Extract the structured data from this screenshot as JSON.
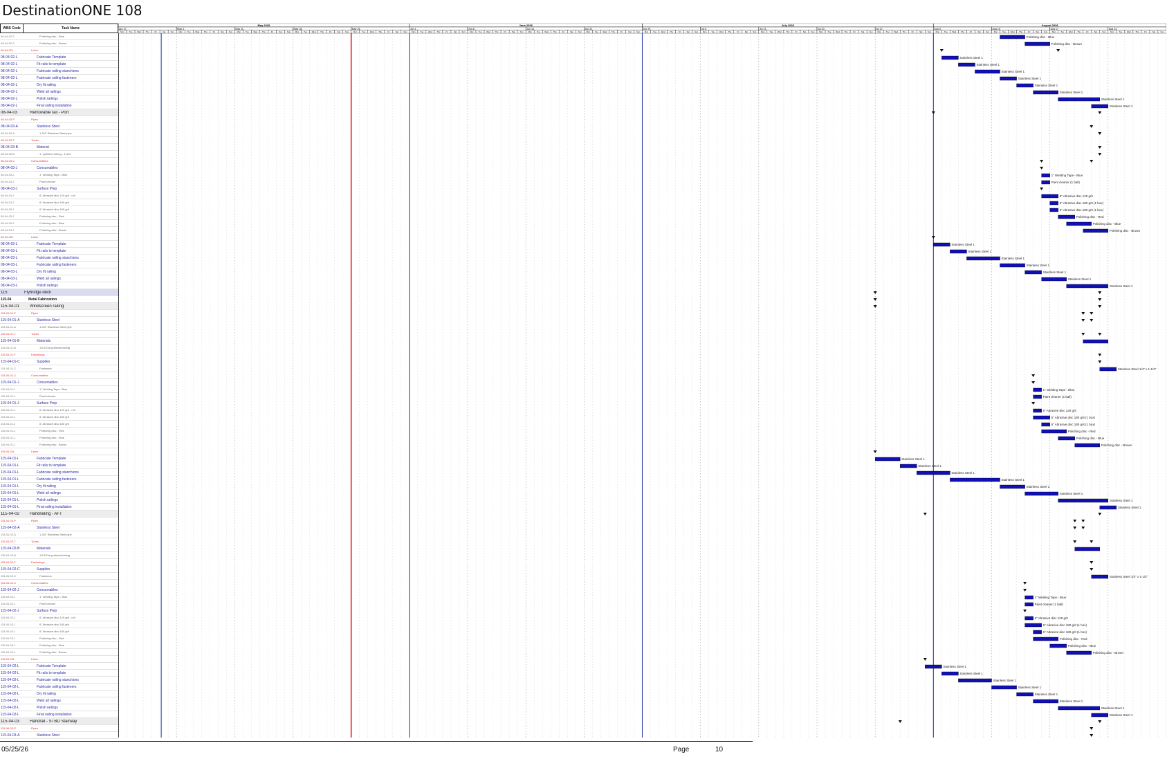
{
  "title": "DestinationONE 108",
  "columns": {
    "wbs": "WBS Code",
    "task": "Task Name"
  },
  "months": [
    {
      "label": "May 2026",
      "start": "2026-04-27",
      "end": "2026-05-31"
    },
    {
      "label": "June 2026",
      "start": "2026-06-01",
      "end": "2026-06-28"
    },
    {
      "label": "July 2026",
      "start": "2026-06-29",
      "end": "2026-08-02"
    },
    {
      "label": "August 2026",
      "start": "2026-08-03",
      "end": "2026-08-30"
    }
  ],
  "weeks": [
    "Apr 27",
    "May 4",
    "May 11",
    "May 18",
    "May 25",
    "Jun 1",
    "Jun 8",
    "Jun 15",
    "Jun 22",
    "Jun 29",
    "Jul 6",
    "Jul 13",
    "Jul 20",
    "Jul 27",
    "Aug 3",
    "Aug 10",
    "Aug 17",
    "Aug 24"
  ],
  "weekdays": [
    "Mon",
    "Tue",
    "Wed",
    "Thu",
    "Fri",
    "Sat",
    "Sun"
  ],
  "rows": [
    {
      "code": "08-04-02-2",
      "name": "Polishing disc - Blue",
      "type": "sub",
      "bar": [
        "2026-08-11",
        "2026-08-13"
      ],
      "label": "Polishing disc - Blue"
    },
    {
      "code": "08-04-02-2",
      "name": "Polishing disc - Brown",
      "type": "sub",
      "bar": [
        "2026-08-14",
        "2026-08-16"
      ],
      "label": "Polishing disc - Brown"
    },
    {
      "code": "08-04-02L",
      "name": "Labor",
      "type": "cat",
      "ms": [
        "2026-08-04",
        "2026-08-18"
      ]
    },
    {
      "code": "08-04-02-L",
      "name": "Fabricate Template",
      "type": "task",
      "bar": [
        "2026-08-04",
        "2026-08-05"
      ],
      "label": "Stainless Steel 1"
    },
    {
      "code": "08-04-02-L",
      "name": "Fit rails to template",
      "type": "task",
      "bar": [
        "2026-08-06",
        "2026-08-07"
      ],
      "label": "Stainless Steel 1"
    },
    {
      "code": "08-04-02-L",
      "name": "Fabricate railing stanchions",
      "type": "task",
      "bar": [
        "2026-08-08",
        "2026-08-10"
      ],
      "label": "Stainless Steel 1"
    },
    {
      "code": "08-04-02-L",
      "name": "Fabricate railing fasteners",
      "type": "task",
      "bar": [
        "2026-08-11",
        "2026-08-12"
      ],
      "label": "Stainless Steel 1"
    },
    {
      "code": "08-04-02-L",
      "name": "Dry fit railing",
      "type": "task",
      "bar": [
        "2026-08-13",
        "2026-08-14"
      ],
      "label": "Stainless Steel 1"
    },
    {
      "code": "08-04-02-L",
      "name": "Weld all railings",
      "type": "task",
      "bar": [
        "2026-08-15",
        "2026-08-17"
      ],
      "label": "Stainless Steel 1"
    },
    {
      "code": "08-04-02-L",
      "name": "Polish railings",
      "type": "task",
      "bar": [
        "2026-08-18",
        "2026-08-22"
      ],
      "label": "Stainless Steel 1"
    },
    {
      "code": "08-04-02-L",
      "name": "Final railing installation",
      "type": "task",
      "bar": [
        "2026-08-22",
        "2026-08-23"
      ],
      "label": "Stainless Steel 1"
    },
    {
      "code": "08-04-03",
      "name": "Removable rail - Port",
      "type": "group",
      "ms": [
        "2026-08-03",
        "2026-08-23"
      ]
    },
    {
      "code": "08-04-03-P",
      "name": "Pipes",
      "type": "cat"
    },
    {
      "code": "08-04-03-A",
      "name": "Stainless Steel",
      "type": "task",
      "ms": [
        "2026-08-22"
      ]
    },
    {
      "code": "08-04-03-A",
      "name": "1-3/4\" Stainless Steel pipe",
      "type": "sub",
      "ms": [
        "2026-08-23"
      ]
    },
    {
      "code": "08-04-03-T",
      "name": "Tubes",
      "type": "cat"
    },
    {
      "code": "08-04-03-B",
      "name": "Material",
      "type": "task",
      "ms": [
        "2026-08-23"
      ]
    },
    {
      "code": "08-04-03-B",
      "name": "1\" polished tubing - 4 feet",
      "type": "sub",
      "ms": [
        "2026-08-23"
      ]
    },
    {
      "code": "08-04-03-C",
      "name": "Consumables",
      "type": "cat",
      "ms": [
        "2026-08-16",
        "2026-08-22"
      ]
    },
    {
      "code": "08-04-03-J",
      "name": "Consumables",
      "type": "task",
      "ms": [
        "2026-08-16"
      ]
    },
    {
      "code": "08-04-03-J",
      "name": "1\" Welding Tape - Blue",
      "type": "sub",
      "bar": [
        "2026-08-16",
        "2026-08-16"
      ],
      "label": "1\" Welding Tape - Blue"
    },
    {
      "code": "08-04-03-J",
      "name": "Paint cleaner",
      "type": "sub",
      "bar": [
        "2026-08-16",
        "2026-08-16"
      ],
      "label": "Paint cleaner (1 ball)"
    },
    {
      "code": "08-04-03-J",
      "name": "Surface Prep",
      "type": "task",
      "ms": [
        "2026-08-16"
      ]
    },
    {
      "code": "08-04-03-J",
      "name": "6\" Abrasive disc 120 grit - roll",
      "type": "sub",
      "bar": [
        "2026-08-16",
        "2026-08-17"
      ],
      "label": "6\" Abrasive disc 120 grit"
    },
    {
      "code": "08-04-03-J",
      "name": "6\" Abrasive disc 180 grit",
      "type": "sub",
      "bar": [
        "2026-08-17",
        "2026-08-17"
      ],
      "label": "6\" Abrasive disc 180 grit (1 box)"
    },
    {
      "code": "08-04-03-J",
      "name": "6\" Abrasive disc 180 grit",
      "type": "sub",
      "bar": [
        "2026-08-17",
        "2026-08-17"
      ],
      "label": "6\" Abrasive disc 180 grit (1 box)"
    },
    {
      "code": "08-04-03-J",
      "name": "Polishing disc - Red",
      "type": "sub",
      "bar": [
        "2026-08-18",
        "2026-08-19"
      ],
      "label": "Polishing disc - Red"
    },
    {
      "code": "08-04-03-J",
      "name": "Polishing disc - Blue",
      "type": "sub",
      "bar": [
        "2026-08-19",
        "2026-08-21"
      ],
      "label": "Polishing disc - Blue"
    },
    {
      "code": "08-04-03-J",
      "name": "Polishing disc - Brown",
      "type": "sub",
      "bar": [
        "2026-08-21",
        "2026-08-23"
      ],
      "label": "Polishing disc - Brown"
    },
    {
      "code": "08-04-03L",
      "name": "Labor",
      "type": "cat",
      "ms": [
        "2026-08-03"
      ]
    },
    {
      "code": "08-04-03-L",
      "name": "Fabricate Template",
      "type": "task",
      "bar": [
        "2026-08-03",
        "2026-08-04"
      ],
      "label": "Stainless Steel 1"
    },
    {
      "code": "08-04-03-L",
      "name": "Fit rails to template",
      "type": "task",
      "bar": [
        "2026-08-05",
        "2026-08-06"
      ],
      "label": "Stainless Steel 1"
    },
    {
      "code": "08-04-03-L",
      "name": "Fabricate railing stanchions",
      "type": "task",
      "bar": [
        "2026-08-07",
        "2026-08-10"
      ],
      "label": "Stainless Steel 1"
    },
    {
      "code": "08-04-03-L",
      "name": "Fabricate railing fasteners",
      "type": "task",
      "bar": [
        "2026-08-11",
        "2026-08-13"
      ],
      "label": "Stainless Steel 1"
    },
    {
      "code": "08-04-03-L",
      "name": "Dry fit railing",
      "type": "task",
      "bar": [
        "2026-08-14",
        "2026-08-15"
      ],
      "label": "Stainless Steel 1"
    },
    {
      "code": "08-04-03-L",
      "name": "Weld all railings",
      "type": "task",
      "bar": [
        "2026-08-16",
        "2026-08-18"
      ],
      "label": "Stainless Steel 1"
    },
    {
      "code": "08-04-03-L",
      "name": "Polish railings",
      "type": "task",
      "bar": [
        "2026-08-19",
        "2026-08-23"
      ],
      "label": "Stainless Steel 1"
    },
    {
      "code": "115",
      "name": "Flybridge deck",
      "type": "phase",
      "ms": [
        "2026-07-27",
        "2026-08-23"
      ]
    },
    {
      "code": "115-04",
      "name": "Metal Fabrication",
      "type": "fab",
      "ms": [
        "2026-07-27",
        "2026-08-23"
      ]
    },
    {
      "code": "115-04-01",
      "name": "Windscreen railing",
      "type": "group",
      "ms": [
        "2026-07-27",
        "2026-08-23"
      ]
    },
    {
      "code": "115-04-01-P",
      "name": "Pipes",
      "type": "cat",
      "ms": [
        "2026-08-21",
        "2026-08-22"
      ]
    },
    {
      "code": "115-04-01-A",
      "name": "Stainless Steel",
      "type": "task",
      "ms": [
        "2026-08-21",
        "2026-08-22"
      ]
    },
    {
      "code": "115-04-01-A",
      "name": "1-3/4\" Stainless Steel pipe",
      "type": "sub"
    },
    {
      "code": "115-04-01-T",
      "name": "Tubes",
      "type": "cat",
      "ms": [
        "2026-08-21",
        "2026-08-23"
      ]
    },
    {
      "code": "115-04-01-B",
      "name": "Materials",
      "type": "task",
      "bar": [
        "2026-08-21",
        "2026-08-23"
      ]
    },
    {
      "code": "115-04-01-B",
      "name": "1/3.5 Dia polished tubing",
      "type": "sub"
    },
    {
      "code": "115-04-01-F",
      "name": "Fastenings",
      "type": "cat",
      "ms": [
        "2026-08-23"
      ]
    },
    {
      "code": "115-04-01-C",
      "name": "Supplies",
      "type": "task",
      "ms": [
        "2026-08-23"
      ]
    },
    {
      "code": "115-04-01-C",
      "name": "Fasteners",
      "type": "sub",
      "bar": [
        "2026-08-23",
        "2026-08-24"
      ],
      "label": "Stainless Steel 1/4\" x 1-1/2\""
    },
    {
      "code": "115-04-01-C",
      "name": "Consumables",
      "type": "cat",
      "ms": [
        "2026-08-15"
      ]
    },
    {
      "code": "115-04-01-J",
      "name": "Consumables",
      "type": "task",
      "ms": [
        "2026-08-15"
      ]
    },
    {
      "code": "115-04-01-J",
      "name": "1\" Welding Tape - Blue",
      "type": "sub",
      "bar": [
        "2026-08-15",
        "2026-08-15"
      ],
      "label": "1\" Welding Tape - Blue"
    },
    {
      "code": "115-04-01-J",
      "name": "Paint cleaner",
      "type": "sub",
      "bar": [
        "2026-08-15",
        "2026-08-15"
      ],
      "label": "Paint cleaner (1 ball)"
    },
    {
      "code": "115-04-01-J",
      "name": "Surface Prep",
      "type": "task",
      "ms": [
        "2026-08-15"
      ]
    },
    {
      "code": "115-04-01-J",
      "name": "6\" Abrasive disc 120 grit - roll",
      "type": "sub",
      "bar": [
        "2026-08-15",
        "2026-08-15"
      ],
      "label": "6\" Abrasive disc 120 grit"
    },
    {
      "code": "115-04-01-J",
      "name": "6\" Abrasive disc 180 grit",
      "type": "sub",
      "bar": [
        "2026-08-15",
        "2026-08-16"
      ],
      "label": "6\" Abrasive disc 180 grit (1 box)"
    },
    {
      "code": "115-04-01-J",
      "name": "6\" Abrasive disc 180 grit",
      "type": "sub",
      "bar": [
        "2026-08-16",
        "2026-08-16"
      ],
      "label": "6\" Abrasive disc 180 grit (1 box)"
    },
    {
      "code": "115-04-01-J",
      "name": "Polishing disc - Red",
      "type": "sub",
      "bar": [
        "2026-08-16",
        "2026-08-18"
      ],
      "label": "Polishing disc - Red"
    },
    {
      "code": "115-04-01-J",
      "name": "Polishing disc - Blue",
      "type": "sub",
      "bar": [
        "2026-08-18",
        "2026-08-19"
      ],
      "label": "Polishing disc - Blue"
    },
    {
      "code": "115-04-01-J",
      "name": "Polishing disc - Brown",
      "type": "sub",
      "bar": [
        "2026-08-20",
        "2026-08-22"
      ],
      "label": "Polishing disc - Brown"
    },
    {
      "code": "115-04-01L",
      "name": "Labor",
      "type": "cat",
      "ms": [
        "2026-07-27"
      ]
    },
    {
      "code": "115-04-01-L",
      "name": "Fabricate Template",
      "type": "task",
      "bar": [
        "2026-07-27",
        "2026-07-29"
      ],
      "label": "Stainless Steel 1"
    },
    {
      "code": "115-04-01-L",
      "name": "Fit rails to template",
      "type": "task",
      "bar": [
        "2026-07-30",
        "2026-07-31"
      ],
      "label": "Stainless Steel 1"
    },
    {
      "code": "115-04-01-L",
      "name": "Fabricate railing stanchions",
      "type": "task",
      "bar": [
        "2026-08-01",
        "2026-08-04"
      ],
      "label": "Stainless Steel 1"
    },
    {
      "code": "115-04-01-L",
      "name": "Fabricate railing fasteners",
      "type": "task",
      "bar": [
        "2026-08-05",
        "2026-08-10"
      ],
      "label": "Stainless Steel 1"
    },
    {
      "code": "115-04-01-L",
      "name": "Dry fit railing",
      "type": "task",
      "bar": [
        "2026-08-11",
        "2026-08-13"
      ],
      "label": "Stainless Steel 1"
    },
    {
      "code": "115-04-01-L",
      "name": "Weld all railings",
      "type": "task",
      "bar": [
        "2026-08-14",
        "2026-08-17"
      ],
      "label": "Stainless Steel 1"
    },
    {
      "code": "115-04-01-L",
      "name": "Polish railings",
      "type": "task",
      "bar": [
        "2026-08-18",
        "2026-08-23"
      ],
      "label": "Stainless Steel 1"
    },
    {
      "code": "115-04-01-L",
      "name": "Final railing installation",
      "type": "task",
      "bar": [
        "2026-08-23",
        "2026-08-24"
      ],
      "label": "Stainless Steel 1"
    },
    {
      "code": "115-04-02",
      "name": "Handrailing - AFT",
      "type": "group",
      "ms": [
        "2026-08-02",
        "2026-08-23"
      ]
    },
    {
      "code": "115-04-02-P",
      "name": "Pipes",
      "type": "cat",
      "ms": [
        "2026-08-20",
        "2026-08-21"
      ]
    },
    {
      "code": "115-04-02-A",
      "name": "Stainless Steel",
      "type": "task",
      "ms": [
        "2026-08-20",
        "2026-08-21"
      ]
    },
    {
      "code": "115-04-02-A",
      "name": "1-3/4\" Stainless Steel pipe",
      "type": "sub"
    },
    {
      "code": "115-04-02-T",
      "name": "Tubes",
      "type": "cat",
      "ms": [
        "2026-08-20",
        "2026-08-22"
      ]
    },
    {
      "code": "115-04-02-B",
      "name": "Materials",
      "type": "task",
      "bar": [
        "2026-08-20",
        "2026-08-22"
      ]
    },
    {
      "code": "115-04-02-B",
      "name": "1/3.5 Dia polished tubing",
      "type": "sub"
    },
    {
      "code": "115-04-02-F",
      "name": "Fastenings",
      "type": "cat",
      "ms": [
        "2026-08-22"
      ]
    },
    {
      "code": "115-04-02-C",
      "name": "Supplies",
      "type": "task",
      "ms": [
        "2026-08-22"
      ]
    },
    {
      "code": "115-04-02-C",
      "name": "Fasteners",
      "type": "sub",
      "bar": [
        "2026-08-22",
        "2026-08-23"
      ],
      "label": "Stainless Steel 1/4\" x 1-1/2\""
    },
    {
      "code": "115-04-02-C",
      "name": "Consumables",
      "type": "cat",
      "ms": [
        "2026-08-14"
      ]
    },
    {
      "code": "115-04-02-J",
      "name": "Consumables",
      "type": "task",
      "ms": [
        "2026-08-14"
      ]
    },
    {
      "code": "115-04-02-J",
      "name": "1\" Welding Tape - Blue",
      "type": "sub",
      "bar": [
        "2026-08-14",
        "2026-08-14"
      ],
      "label": "1\" Welding Tape - Blue"
    },
    {
      "code": "115-04-02-J",
      "name": "Paint cleaner",
      "type": "sub",
      "bar": [
        "2026-08-14",
        "2026-08-14"
      ],
      "label": "Paint cleaner (1 ball)"
    },
    {
      "code": "115-04-02-J",
      "name": "Surface Prep",
      "type": "task",
      "ms": [
        "2026-08-14"
      ]
    },
    {
      "code": "115-04-02-J",
      "name": "6\" Abrasive disc 120 grit - roll",
      "type": "sub",
      "bar": [
        "2026-08-14",
        "2026-08-14"
      ],
      "label": "6\" Abrasive disc 120 grit"
    },
    {
      "code": "115-04-02-J",
      "name": "6\" Abrasive disc 180 grit",
      "type": "sub",
      "bar": [
        "2026-08-14",
        "2026-08-15"
      ],
      "label": "6\" Abrasive disc 180 grit (1 box)"
    },
    {
      "code": "115-04-02-J",
      "name": "6\" Abrasive disc 180 grit",
      "type": "sub",
      "bar": [
        "2026-08-15",
        "2026-08-15"
      ],
      "label": "6\" Abrasive disc 180 grit (1 box)"
    },
    {
      "code": "115-04-02-J",
      "name": "Polishing disc - Red",
      "type": "sub",
      "bar": [
        "2026-08-15",
        "2026-08-17"
      ],
      "label": "Polishing disc - Red"
    },
    {
      "code": "115-04-02-J",
      "name": "Polishing disc - Blue",
      "type": "sub",
      "bar": [
        "2026-08-17",
        "2026-08-18"
      ],
      "label": "Polishing disc - Blue"
    },
    {
      "code": "115-04-02-J",
      "name": "Polishing disc - Brown",
      "type": "sub",
      "bar": [
        "2026-08-19",
        "2026-08-21"
      ],
      "label": "Polishing disc - Brown"
    },
    {
      "code": "115-04-02L",
      "name": "Labor",
      "type": "cat",
      "ms": [
        "2026-08-02"
      ]
    },
    {
      "code": "115-04-02-L",
      "name": "Fabricate Template",
      "type": "task",
      "bar": [
        "2026-08-02",
        "2026-08-03"
      ],
      "label": "Stainless Steel 1"
    },
    {
      "code": "115-04-02-L",
      "name": "Fit rails to template",
      "type": "task",
      "bar": [
        "2026-08-04",
        "2026-08-05"
      ],
      "label": "Stainless Steel 1"
    },
    {
      "code": "115-04-02-L",
      "name": "Fabricate railing stanchions",
      "type": "task",
      "bar": [
        "2026-08-06",
        "2026-08-09"
      ],
      "label": "Stainless Steel 1"
    },
    {
      "code": "115-04-02-L",
      "name": "Fabricate railing fasteners",
      "type": "task",
      "bar": [
        "2026-08-10",
        "2026-08-12"
      ],
      "label": "Stainless Steel 1"
    },
    {
      "code": "115-04-02-L",
      "name": "Dry fit railing",
      "type": "task",
      "bar": [
        "2026-08-13",
        "2026-08-14"
      ],
      "label": "Stainless Steel 1"
    },
    {
      "code": "115-04-02-L",
      "name": "Weld all railings",
      "type": "task",
      "bar": [
        "2026-08-15",
        "2026-08-17"
      ],
      "label": "Stainless Steel 1"
    },
    {
      "code": "115-04-02-L",
      "name": "Polish railings",
      "type": "task",
      "bar": [
        "2026-08-18",
        "2026-08-22"
      ],
      "label": "Stainless Steel 1"
    },
    {
      "code": "115-04-02-L",
      "name": "Final railing installation",
      "type": "task",
      "bar": [
        "2026-08-22",
        "2026-08-23"
      ],
      "label": "Stainless Steel 1"
    },
    {
      "code": "115-04-03",
      "name": "Handrail - STBD Stairway",
      "type": "group",
      "ms": [
        "2026-07-30",
        "2026-08-23"
      ]
    },
    {
      "code": "115-04-03-P",
      "name": "Pipes",
      "type": "cat",
      "ms": [
        "2026-08-22"
      ]
    },
    {
      "code": "115-04-03-A",
      "name": "Stainless Steel",
      "type": "task",
      "ms": [
        "2026-08-22"
      ]
    }
  ],
  "status_date": "2026-05-25",
  "footer": {
    "date": "05/25/26",
    "page_label": "Page",
    "page_number": "10"
  }
}
